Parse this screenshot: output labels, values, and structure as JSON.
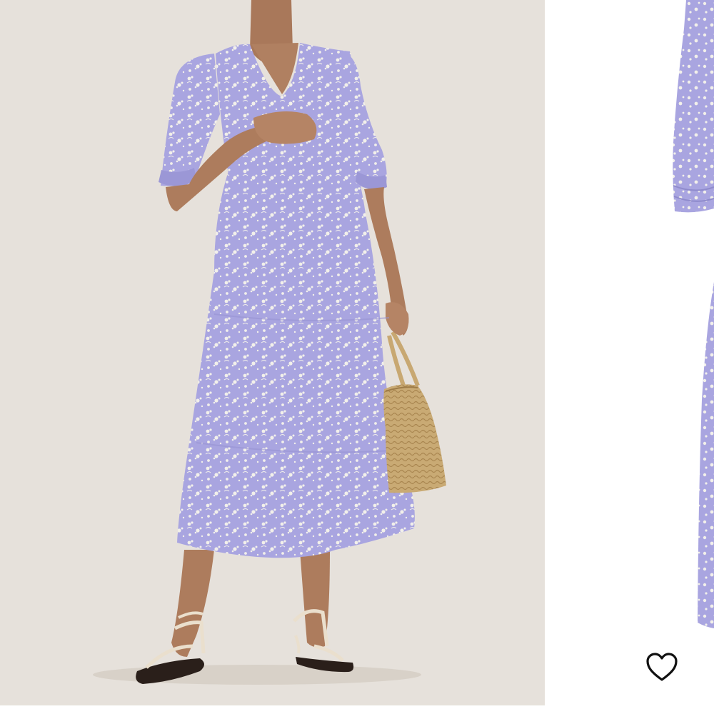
{
  "gallery": {
    "slides": [
      {
        "subject": "model-wearing-dress-with-straw-bag"
      },
      {
        "subject": "dress-flat-lay-partial"
      }
    ],
    "favorite": {
      "icon": "heart-outline-icon"
    }
  },
  "colors": {
    "main_background": "#e6e1db",
    "dress_lavender": "#a7a3df",
    "print_white": "#f1efe8",
    "skin": "#b07f60",
    "basket_straw": "#c8a872",
    "sandal_strap": "#eadfcd",
    "page_background": "#ffffff",
    "icon_stroke": "#111111"
  }
}
